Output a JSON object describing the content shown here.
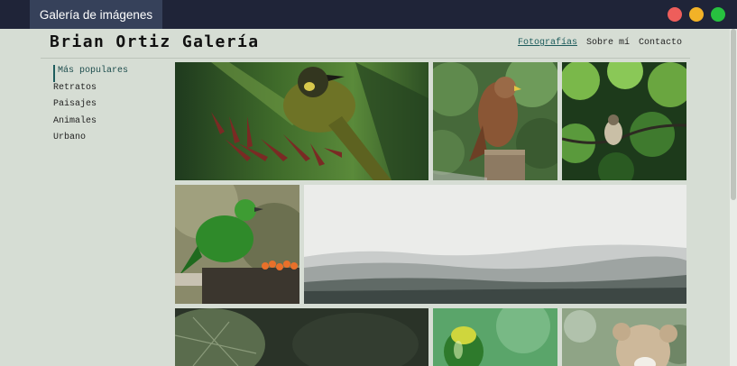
{
  "browser": {
    "tab_title": "Galería de imágenes"
  },
  "site": {
    "title": "Brian Ortiz Galería"
  },
  "topnav": {
    "items": [
      "Fotografías",
      "Sobre mí",
      "Contacto"
    ],
    "active": "Fotografías"
  },
  "sidebar": {
    "items": [
      "Más populares",
      "Retratos",
      "Paisajes",
      "Animales",
      "Urbano"
    ],
    "active": "Más populares"
  },
  "gallery": {
    "photos": [
      {
        "subject": "yellow-eared bird on red flower"
      },
      {
        "subject": "kestrel on post"
      },
      {
        "subject": "small bird in tree"
      },
      {
        "subject": "green bird on stump"
      },
      {
        "subject": "misty forest landscape"
      },
      {
        "subject": "large leaves"
      },
      {
        "subject": "green beetle"
      },
      {
        "subject": "teddy bear in flowers"
      }
    ]
  },
  "colors": {
    "chrome": "#1f2438",
    "tab": "#36415a",
    "page_bg": "#d6ddd4",
    "accent": "#1d5c5c"
  }
}
